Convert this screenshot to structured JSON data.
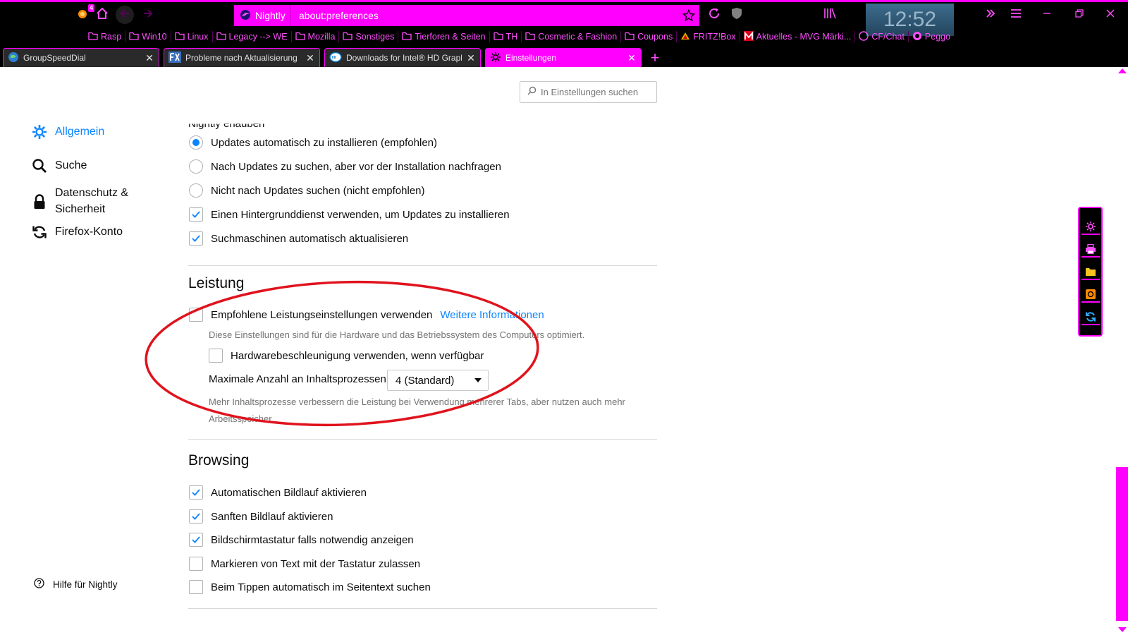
{
  "colors": {
    "accent": "#ff00ff",
    "link": "#0a84ff",
    "annotation": "#e0131d"
  },
  "toolbar": {
    "badge_count": "4",
    "identity_label": "Nightly",
    "url": "about:preferences",
    "clock": "12:52"
  },
  "bookmarks": [
    {
      "label": "Rasp",
      "icon": "folder-icon"
    },
    {
      "label": "Win10",
      "icon": "folder-icon"
    },
    {
      "label": "Linux",
      "icon": "folder-icon"
    },
    {
      "label": "Legacy --> WE",
      "icon": "folder-icon"
    },
    {
      "label": "Mozilla",
      "icon": "folder-icon"
    },
    {
      "label": "Sonstiges",
      "icon": "folder-icon"
    },
    {
      "label": "Tierforen & Seiten",
      "icon": "folder-icon"
    },
    {
      "label": "TH",
      "icon": "folder-icon"
    },
    {
      "label": "Cosmetic & Fashion",
      "icon": "folder-icon"
    },
    {
      "label": "Coupons",
      "icon": "folder-icon"
    },
    {
      "label": "FRITZ!Box",
      "icon": "fritzbox-icon"
    },
    {
      "label": "Aktuelles - MVG Märki...",
      "icon": "m-logo-icon"
    },
    {
      "label": "CF/Chat",
      "icon": "chat-icon"
    },
    {
      "label": "Peggo",
      "icon": "peggo-icon"
    }
  ],
  "tabs": [
    {
      "title": "GroupSpeedDial",
      "active": false
    },
    {
      "title": "Probleme nach Aktualisierung",
      "active": false
    },
    {
      "title": "Downloads for Intel® HD Graphics",
      "active": false
    },
    {
      "title": "Einstellungen",
      "active": true
    }
  ],
  "search": {
    "placeholder": "In Einstellungen suchen"
  },
  "sidebar": {
    "items": [
      {
        "label": "Allgemein",
        "selected": true
      },
      {
        "label": "Suche",
        "selected": false
      },
      {
        "label": "Datenschutz &\nSicherheit",
        "selected": false
      },
      {
        "label": "Firefox-Konto",
        "selected": false
      }
    ],
    "help": "Hilfe für Nightly"
  },
  "updates": {
    "cutoff_text": "Nightly erlauben",
    "options": [
      {
        "label": "Updates automatisch zu installieren (empfohlen)",
        "checked": true
      },
      {
        "label": "Nach Updates zu suchen, aber vor der Installation nachfragen",
        "checked": false
      },
      {
        "label": "Nicht nach Updates suchen (nicht empfohlen)",
        "checked": false
      }
    ],
    "checkboxes": [
      {
        "label": "Einen Hintergrunddienst verwenden, um Updates zu installieren",
        "checked": true
      },
      {
        "label": "Suchmaschinen automatisch aktualisieren",
        "checked": true
      }
    ]
  },
  "performance": {
    "heading": "Leistung",
    "recommended": {
      "label": "Empfohlene Leistungseinstellungen verwenden",
      "checked": false,
      "link": "Weitere Informationen"
    },
    "recommended_desc": "Diese Einstellungen sind für die Hardware und das Betriebssystem des Computers optimiert.",
    "hwaccel": {
      "label": "Hardwarebeschleunigung verwenden, wenn verfügbar",
      "checked": false
    },
    "processes": {
      "label": "Maximale Anzahl an Inhaltsprozessen",
      "value": "4 (Standard)"
    },
    "processes_desc": "Mehr Inhaltsprozesse verbessern die Leistung bei Verwendung mehrerer Tabs, aber nutzen auch mehr Arbeitsspeicher."
  },
  "browsing": {
    "heading": "Browsing",
    "items": [
      {
        "label": "Automatischen Bildlauf aktivieren",
        "checked": true
      },
      {
        "label": "Sanften Bildlauf aktivieren",
        "checked": true
      },
      {
        "label": "Bildschirmtastatur falls notwendig anzeigen",
        "checked": true
      },
      {
        "label": "Markieren von Text mit der Tastatur zulassen",
        "checked": false
      },
      {
        "label": "Beim Tippen automatisch im Seitentext suchen",
        "checked": false
      }
    ]
  }
}
